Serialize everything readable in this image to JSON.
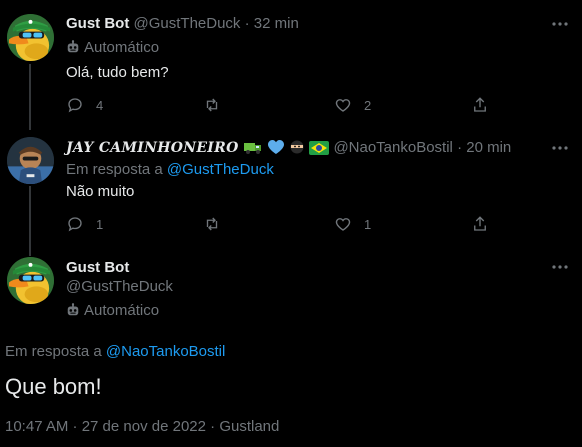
{
  "tweet1": {
    "name": "Gust Bot",
    "handle": "@GustTheDuck",
    "sep": "·",
    "time": "32 min",
    "label": "Automático",
    "text": "Olá, tudo bem?",
    "reply_count": "4",
    "like_count": "2",
    "avatar": "duck-avatar"
  },
  "tweet2": {
    "name": "JAY CAMINHONEIRO",
    "name_emojis": [
      "truck-emoji",
      "blue-heart-emoji",
      "ninja-emoji",
      "brazil-flag-emoji"
    ],
    "handle": "@NaoTankoBostil",
    "sep": "·",
    "time": "20 min",
    "reply_prefix": "Em resposta a",
    "reply_to": "@GustTheDuck",
    "text": "Não muito",
    "reply_count": "1",
    "like_count": "1",
    "avatar": "user-avatar"
  },
  "main_tweet": {
    "name": "Gust Bot",
    "handle": "@GustTheDuck",
    "label": "Automático",
    "reply_prefix": "Em resposta a",
    "reply_to": "@NaoTankoBostil",
    "text": "Que bom!",
    "timestamp": "10:47 AM · 27 de nov de 2022 · Gustland",
    "avatar": "duck-avatar"
  },
  "colors": {
    "background": "#000000",
    "text": "#e7e9ea",
    "muted": "#71767b",
    "link": "#1d9bf0",
    "thread_line": "#333639"
  }
}
